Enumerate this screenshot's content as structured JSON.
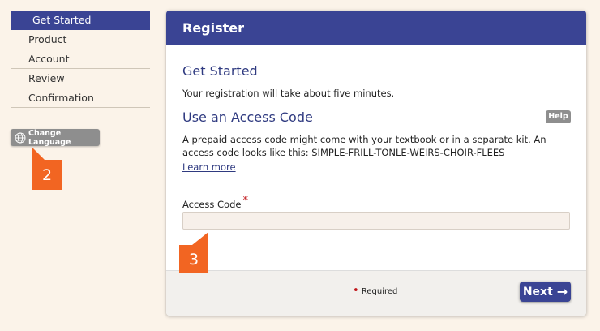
{
  "sidebar": {
    "items": [
      {
        "label": "Get Started"
      },
      {
        "label": "Product"
      },
      {
        "label": "Account"
      },
      {
        "label": "Review"
      },
      {
        "label": "Confirmation"
      }
    ],
    "change_language": "Change Language"
  },
  "callouts": {
    "two": "2",
    "three": "3"
  },
  "panel": {
    "title": "Register",
    "get_started_heading": "Get Started",
    "intro": "Your registration will take about five minutes.",
    "access_heading": "Use an Access Code",
    "help": "Help",
    "description": "A prepaid access code might come with your textbook or in a separate kit. An access code looks like this: SIMPLE-FRILL-TONLE-WEIRS-CHOIR-FLEES",
    "learn_more": "Learn more",
    "access_label": "Access Code",
    "required_star": "*",
    "access_value": ""
  },
  "footer": {
    "required_mark": "•",
    "required": "Required",
    "next": "Next",
    "next_arrow": "→"
  },
  "colors": {
    "accent": "#3a4494",
    "callout": "#f26522",
    "background": "#fbf3e9"
  }
}
